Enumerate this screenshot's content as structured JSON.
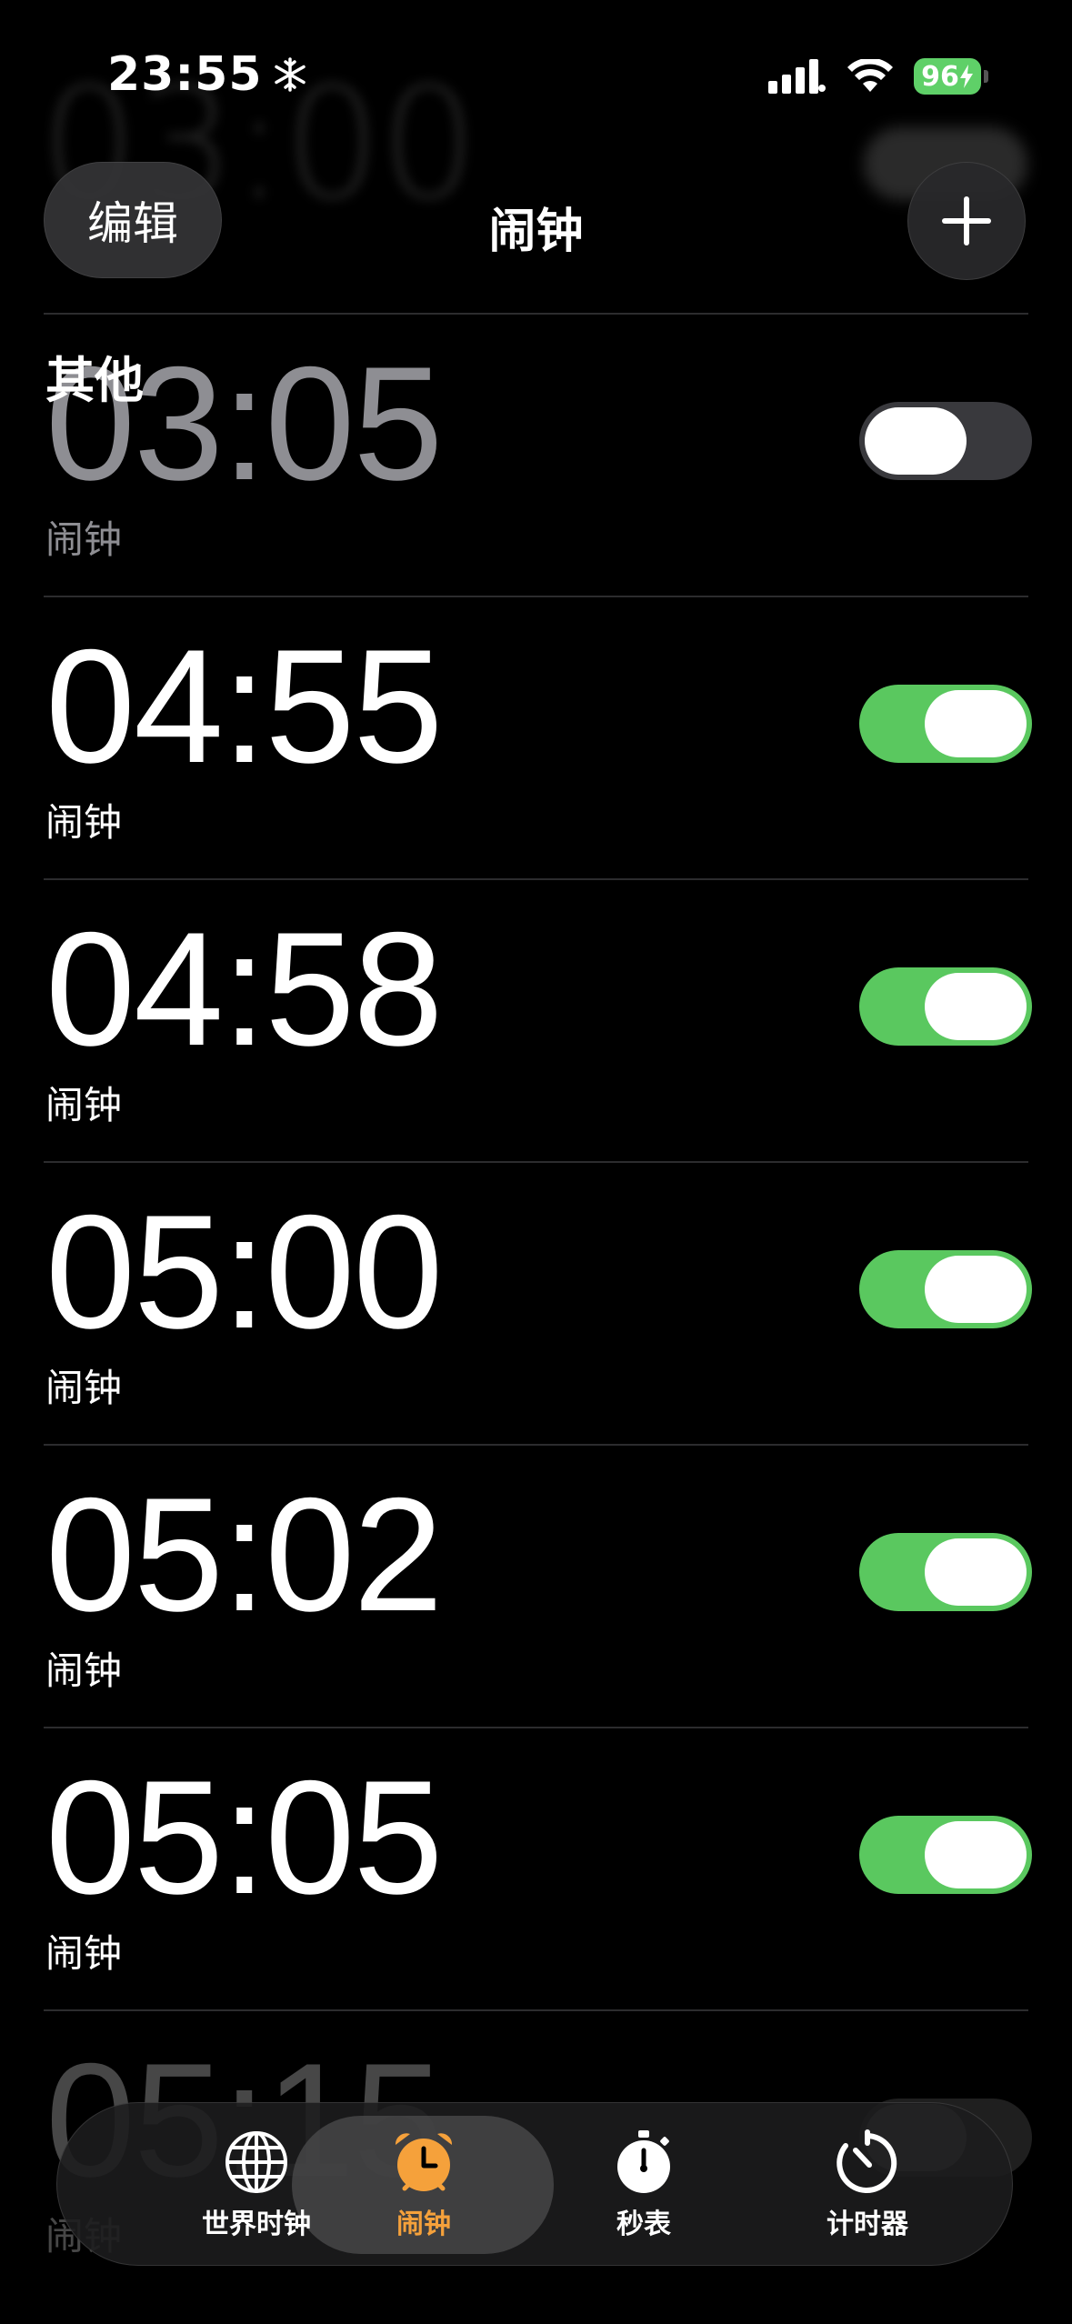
{
  "status_bar": {
    "time": "23:55",
    "battery": "96"
  },
  "nav": {
    "edit_label": "编辑",
    "title": "闹钟",
    "add_icon": "plus-icon"
  },
  "ghost": {
    "time": "03:00"
  },
  "section": {
    "title": "其他"
  },
  "alarms": [
    {
      "time": "03:05",
      "label": "闹钟",
      "enabled": false
    },
    {
      "time": "04:55",
      "label": "闹钟",
      "enabled": true
    },
    {
      "time": "04:58",
      "label": "闹钟",
      "enabled": true
    },
    {
      "time": "05:00",
      "label": "闹钟",
      "enabled": true
    },
    {
      "time": "05:02",
      "label": "闹钟",
      "enabled": true
    },
    {
      "time": "05:05",
      "label": "闹钟",
      "enabled": true
    },
    {
      "time": "05:15",
      "label": "闹钟",
      "enabled": false
    }
  ],
  "tabs": [
    {
      "label": "世界时钟",
      "icon": "globe-icon",
      "active": false
    },
    {
      "label": "闹钟",
      "icon": "alarm-clock-icon",
      "active": true
    },
    {
      "label": "秒表",
      "icon": "stopwatch-icon",
      "active": false
    },
    {
      "label": "计时器",
      "icon": "timer-icon",
      "active": false
    }
  ],
  "colors": {
    "toggle_on": "#5ac85f",
    "active_tab": "#f5a13b",
    "battery": "#5fd068"
  }
}
